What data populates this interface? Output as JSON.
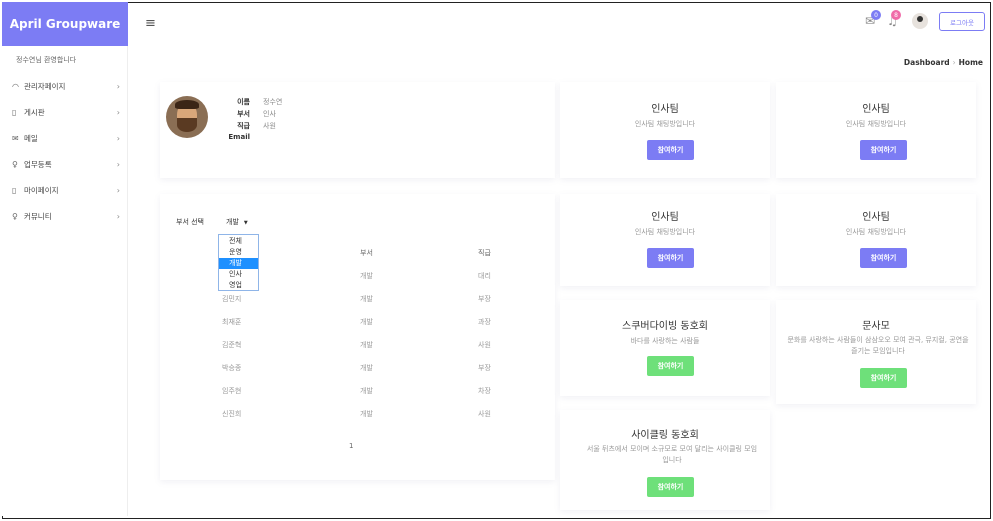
{
  "app": {
    "brand": "April Groupware"
  },
  "sidebar": {
    "welcome": "정수연님 환영합니다",
    "items": [
      {
        "label": "관리자페이지",
        "icon": "speedometer-icon"
      },
      {
        "label": "게시판",
        "icon": "document-icon"
      },
      {
        "label": "메일",
        "icon": "envelope-icon"
      },
      {
        "label": "업무등록",
        "icon": "lightbulb-icon"
      },
      {
        "label": "마이페이지",
        "icon": "page-icon"
      },
      {
        "label": "커뮤니티",
        "icon": "lightbulb-icon"
      }
    ],
    "chevron": "›"
  },
  "header": {
    "menu_icon": "≡",
    "mail_badge": "0",
    "bell_badge": "8",
    "logout": "로그아웃",
    "colors": {
      "accent": "#7c7cf4",
      "mail_badge": "#7c7cf4",
      "bell_badge": "#f06ba8",
      "join_purple": "#7c7cf4",
      "join_green": "#6ee07a"
    }
  },
  "breadcrumb": {
    "first": "Dashboard",
    "sep": "›",
    "second": "Home"
  },
  "profile": {
    "labels": {
      "name": "이름",
      "dept": "부서",
      "rank": "직급",
      "email": "Email"
    },
    "values": {
      "name": "정수연",
      "dept": "인사",
      "rank": "사원",
      "email": ""
    }
  },
  "dept_filter": {
    "label": "부서 선택",
    "selected": "개발",
    "options": [
      "전체",
      "운영",
      "개발",
      "인사",
      "영업"
    ]
  },
  "table": {
    "headers": [
      "",
      "부서",
      "직급"
    ],
    "rows": [
      {
        "name": "",
        "dept": "개발",
        "rank": "대리"
      },
      {
        "name": "김민지",
        "dept": "개발",
        "rank": "부장"
      },
      {
        "name": "최재훈",
        "dept": "개발",
        "rank": "과장"
      },
      {
        "name": "김준혁",
        "dept": "개발",
        "rank": "사원"
      },
      {
        "name": "박승종",
        "dept": "개발",
        "rank": "부장"
      },
      {
        "name": "임주현",
        "dept": "개발",
        "rank": "차장"
      },
      {
        "name": "신진희",
        "dept": "개발",
        "rank": "사원"
      }
    ],
    "page": "1"
  },
  "clubs": [
    {
      "title": "인사팀",
      "desc": "인사팀 채팅방입니다",
      "button": "참여하기",
      "color": "#7c7cf4"
    },
    {
      "title": "인사팀",
      "desc": "인사팀 채팅방입니다",
      "button": "참여하기",
      "color": "#7c7cf4"
    },
    {
      "title": "인사팀",
      "desc": "인사팀 채팅방입니다",
      "button": "참여하기",
      "color": "#7c7cf4"
    },
    {
      "title": "인사팀",
      "desc": "인사팀 채팅방입니다",
      "button": "참여하기",
      "color": "#7c7cf4"
    },
    {
      "title": "스쿠버다이빙 동호회",
      "desc": "바다를 사랑하는 사람들",
      "button": "참여하기",
      "color": "#6ee07a"
    },
    {
      "title": "문사모",
      "desc": "문화를 사랑하는 사람들이 삼삼오오 모여 관극, 뮤지컬, 공연을 즐기는 모임입니다",
      "button": "참여하기",
      "color": "#6ee07a"
    },
    {
      "title": "사이클링 동호회",
      "desc": "서울 뒤츠에서 모이며 소규모로 모여 달리는 사이클링 모임입니다",
      "button": "참여하기",
      "color": "#6ee07a"
    }
  ]
}
